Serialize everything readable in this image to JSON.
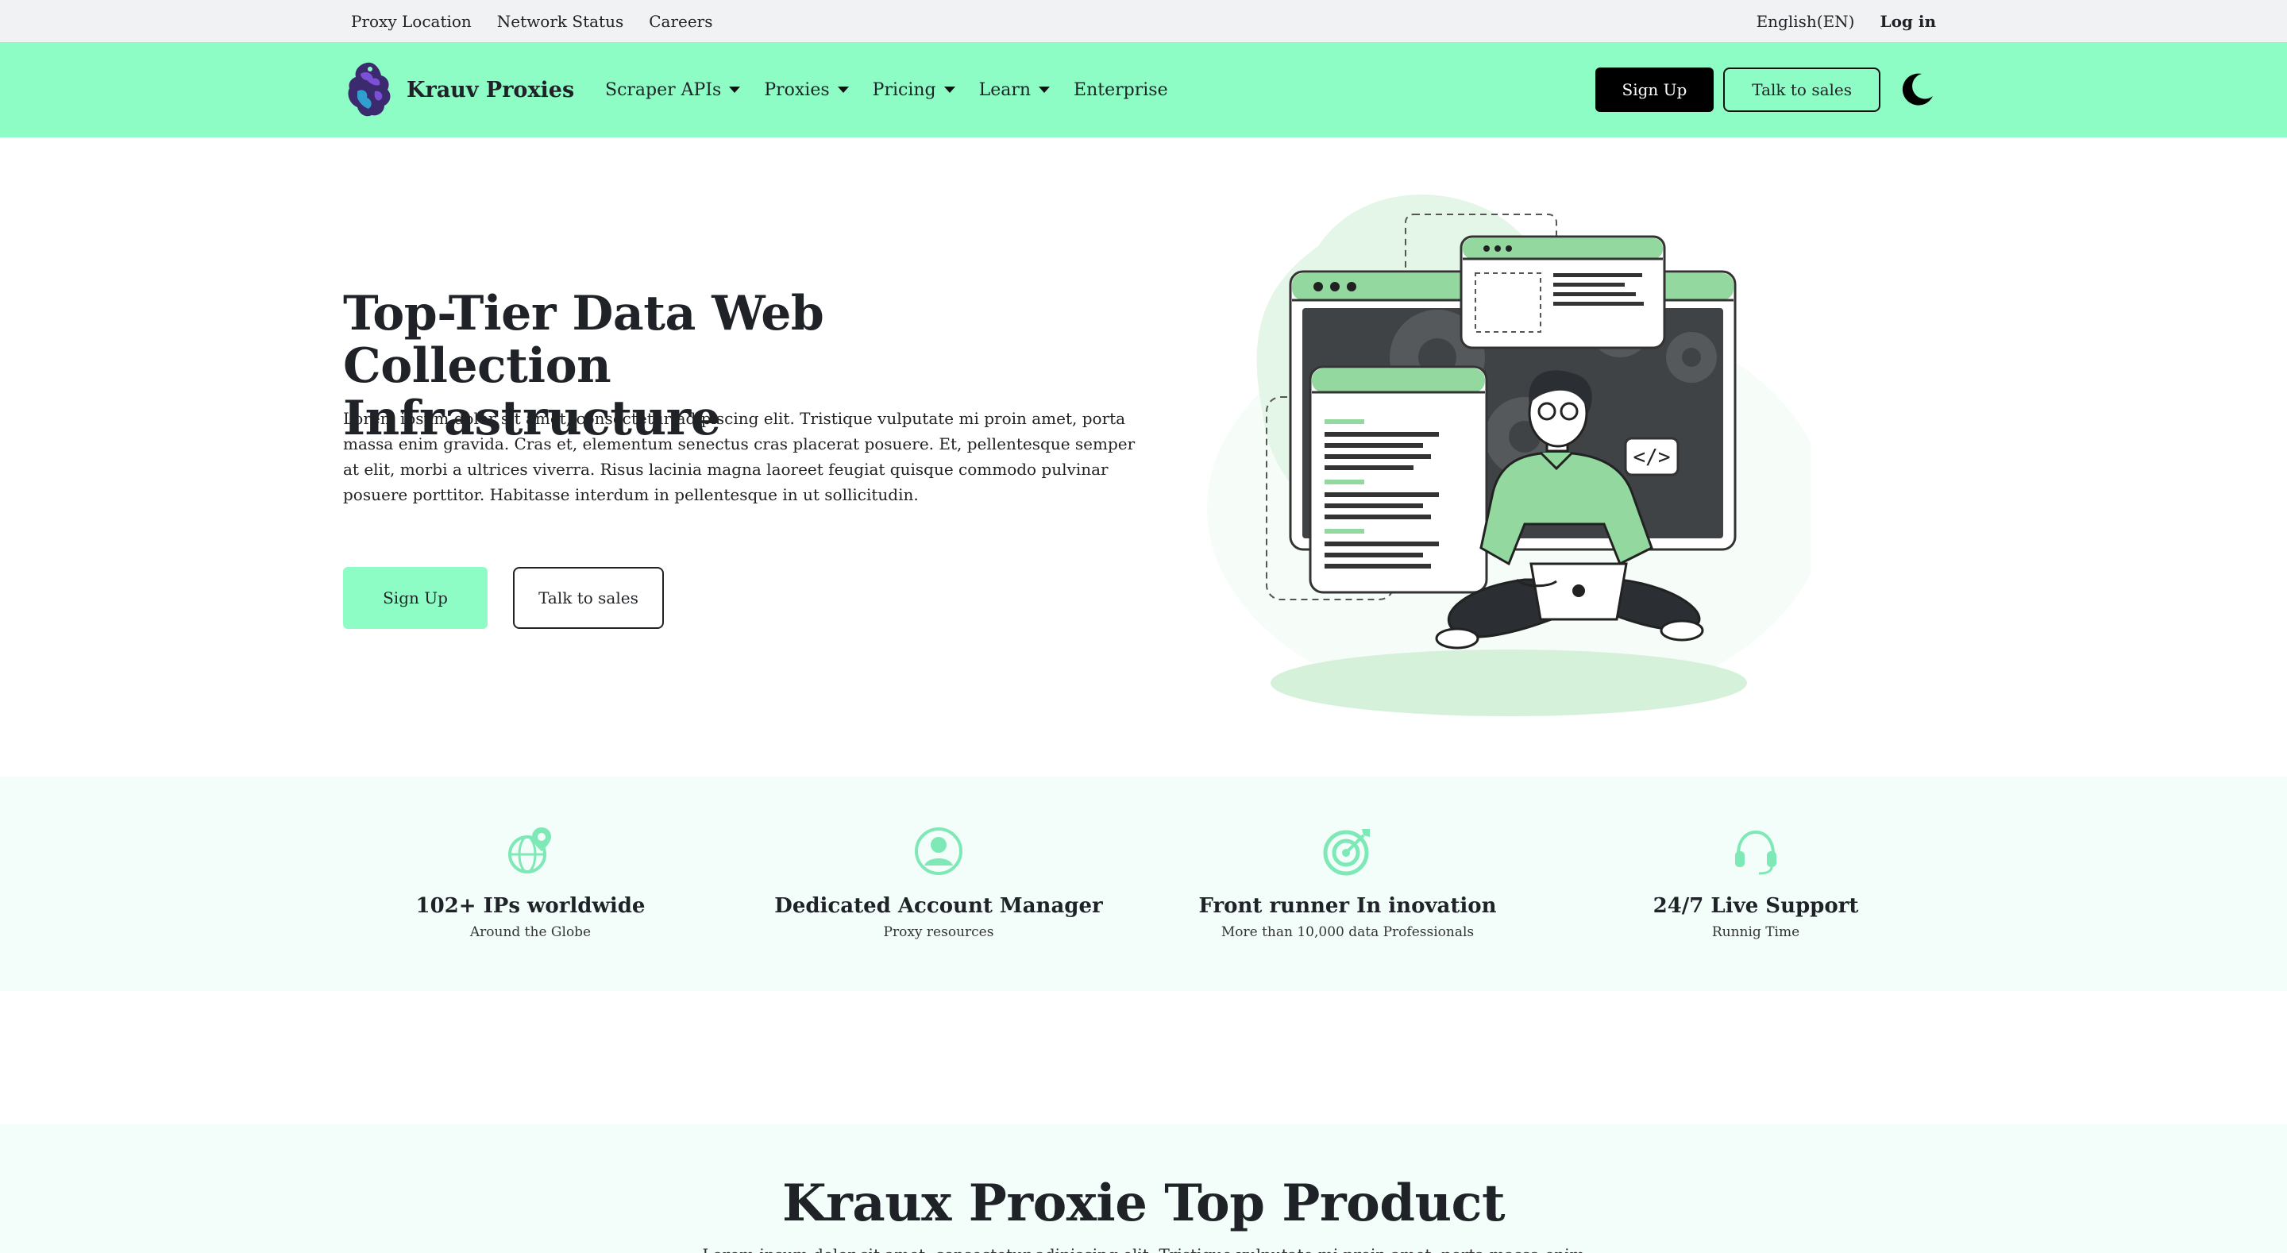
{
  "topbar": {
    "links": [
      "Proxy Location",
      "Network Status",
      "Careers"
    ],
    "language": "English(EN)",
    "login": "Log in"
  },
  "nav": {
    "brand": "Krauv Proxies",
    "menu": [
      {
        "label": "Scraper APIs",
        "dropdown": true
      },
      {
        "label": "Proxies",
        "dropdown": true
      },
      {
        "label": "Pricing",
        "dropdown": true
      },
      {
        "label": "Learn",
        "dropdown": true
      },
      {
        "label": "Enterprise",
        "dropdown": false
      }
    ],
    "signup": "Sign Up",
    "talk": "Talk to sales",
    "theme_icon": "moon-icon"
  },
  "hero": {
    "title_line1": "Top-Tier Data Web Collection",
    "title_line2": "Infrastructure",
    "text": "Lorem ipsum dolor sit amet, consectetur adipiscing elit. Tristique vulputate mi proin amet, porta massa enim gravida. Cras et, elementum senectus cras placerat posuere. Et, pellentesque semper at elit, morbi a ultrices viverra. Risus lacinia magna laoreet feugiat quisque commodo pulvinar posuere porttitor. Habitasse interdum in pellentesque in ut sollicitudin.",
    "signup": "Sign Up",
    "talk": "Talk to sales",
    "code_tag": "</>"
  },
  "features": [
    {
      "icon": "globe-pin-icon",
      "title": "102+ IPs worldwide",
      "subtitle": "Around the Globe"
    },
    {
      "icon": "user-icon",
      "title": "Dedicated Account Manager",
      "subtitle": "Proxy resources"
    },
    {
      "icon": "target-icon",
      "title": "Front runner In inovation",
      "subtitle": "More than 10,000 data Professionals"
    },
    {
      "icon": "headset-icon",
      "title": "24/7 Live Support",
      "subtitle": "Runnig Time"
    }
  ],
  "product": {
    "title": "Kraux Proxie Top Product",
    "subtitle": "Lorem ipsum dolor sit amet, consectetur adipiscing elit. Tristique vulputate mi proin amet, porta massa enim"
  },
  "colors": {
    "mint": "#8dfcc5",
    "mint_icon": "#7ee8b7",
    "band": "#f3fefb",
    "dark": "#000000",
    "illustration_green": "#93d99f"
  }
}
